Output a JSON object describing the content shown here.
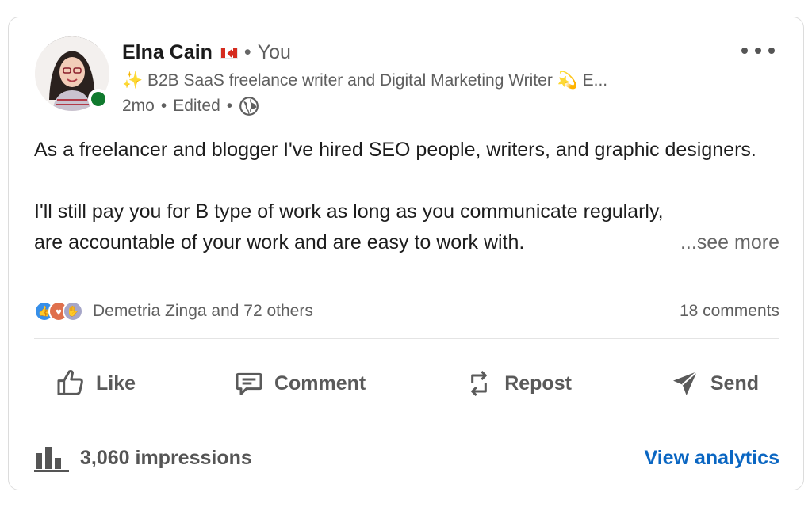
{
  "post": {
    "author_name": "Elna Cain",
    "separator": "•",
    "relation": "You",
    "headline": "✨ B2B SaaS freelance writer and Digital Marketing Writer 💫 E...",
    "time": "2mo",
    "edited": "Edited",
    "body_line1": "As a freelancer and blogger I've hired SEO people, writers, and graphic designers.",
    "body_line2": "I'll still pay you for B type of work as long as you communicate regularly,",
    "body_line3": "are accountable of your work and are easy to work with.",
    "see_more": "...see more",
    "reactions_text": "Demetria Zinga and 72 others",
    "comments_count": "18 comments"
  },
  "actions": {
    "like": "Like",
    "comment": "Comment",
    "repost": "Repost",
    "send": "Send"
  },
  "footer": {
    "impressions": "3,060 impressions",
    "view_analytics": "View analytics"
  },
  "colors": {
    "online": "#107a2e",
    "link": "#0a66c2",
    "muted": "#5f5f5f"
  },
  "icons": {
    "more": "more-horizontal-icon",
    "globe": "globe-icon",
    "like": "thumbs-up-icon",
    "comment": "comment-bubble-icon",
    "repost": "repost-arrows-icon",
    "send": "paper-plane-icon",
    "analytics": "bar-chart-icon"
  }
}
